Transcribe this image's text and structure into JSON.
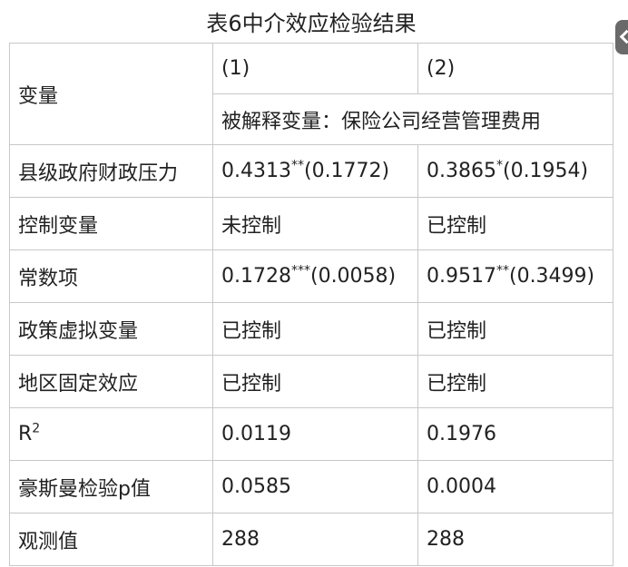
{
  "caption": "表6中介效应检验结果",
  "table": {
    "corner": "变量",
    "col1": "(1)",
    "col2": "(2)",
    "dependent": "被解释变量：保险公司经营管理费用",
    "rows": [
      {
        "label": "县级政府财政压力",
        "v1": "0.4313",
        "s1": "**",
        "se1": "(0.1772)",
        "v2": "0.3865",
        "s2": "*",
        "se2": "(0.1954)"
      },
      {
        "label": "控制变量",
        "v1": "未控制",
        "v2": "已控制"
      },
      {
        "label": "常数项",
        "v1": "0.1728",
        "s1": "***",
        "se1": "(0.0058)",
        "v2": "0.9517",
        "s2": "**",
        "se2": "(0.3499)"
      },
      {
        "label": "政策虚拟变量",
        "v1": "已控制",
        "v2": "已控制"
      },
      {
        "label": "地区固定效应",
        "v1": "已控制",
        "v2": "已控制"
      },
      {
        "label": "R",
        "label_sup": "2",
        "v1": "0.0119",
        "v2": "0.1976"
      },
      {
        "label": "豪斯曼检验p值",
        "v1": "0.0585",
        "v2": "0.0004"
      },
      {
        "label": "观测值",
        "v1": "288",
        "v2": "288"
      }
    ]
  },
  "colors": {
    "border": "#c8c8c8",
    "text": "#222222",
    "side_tab": "#6a6a6a"
  },
  "icons": {
    "side_tab": "chevron-left-icon"
  }
}
